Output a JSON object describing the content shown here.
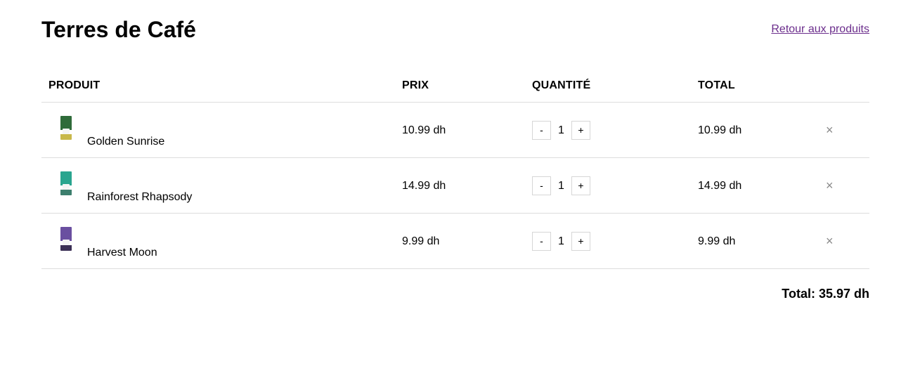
{
  "header": {
    "brand": "Terres de Café",
    "back_link": "Retour aux produits"
  },
  "table": {
    "columns": {
      "product": "PRODUIT",
      "price": "PRIX",
      "quantity": "QUANTITÉ",
      "total": "TOTAL"
    },
    "rows": [
      {
        "name": "Golden Sunrise",
        "price": "10.99 dh",
        "quantity": "1",
        "total": "10.99 dh",
        "decrement": "-",
        "increment": "+",
        "remove": "×",
        "thumb_colors": [
          "#2f6b3a",
          "#c8b84a"
        ]
      },
      {
        "name": "Rainforest Rhapsody",
        "price": "14.99 dh",
        "quantity": "1",
        "total": "14.99 dh",
        "decrement": "-",
        "increment": "+",
        "remove": "×",
        "thumb_colors": [
          "#2aa58f",
          "#3d7f6e"
        ]
      },
      {
        "name": "Harvest Moon",
        "price": "9.99 dh",
        "quantity": "1",
        "total": "9.99 dh",
        "decrement": "-",
        "increment": "+",
        "remove": "×",
        "thumb_colors": [
          "#6a4fa0",
          "#3b2f55"
        ]
      }
    ]
  },
  "summary": {
    "total": "Total: 35.97 dh"
  },
  "colors": {
    "link": "#6b2d8c",
    "divider": "#dddddd",
    "remove_icon": "#8a8a8a"
  }
}
